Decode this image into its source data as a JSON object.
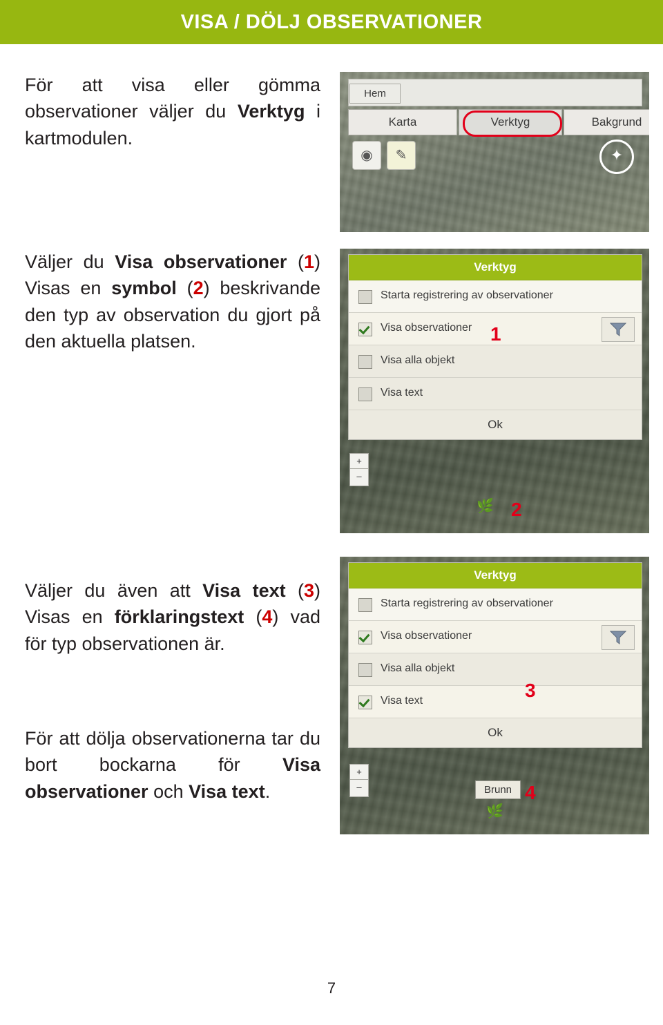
{
  "header": {
    "title": "VISA / DÖLJ OBSERVATIONER"
  },
  "page": {
    "number": "7"
  },
  "paragraphs": {
    "p1": {
      "seg1": "För att visa eller gömma observationer väljer du ",
      "bold1": "Verktyg",
      "seg2": " i kartmodulen."
    },
    "p2": {
      "seg1": "Väljer du ",
      "bold1": "Visa observationer",
      "seg2": " (",
      "num1": "1",
      "seg3": ") Visas en ",
      "bold2": "symbol",
      "seg4": " (",
      "num2": "2",
      "seg5": ") beskrivande den typ av observation du gjort på den aktuella platsen."
    },
    "p3": {
      "seg1": "Väljer du även att ",
      "bold1": "Visa text",
      "seg2": " (",
      "num1": "3",
      "seg3": ") Visas en ",
      "bold2": "förklaringstext",
      "seg4": " (",
      "num2": "4",
      "seg5": ") vad för typ observationen är."
    },
    "p4": {
      "seg1": "För att dölja observationerna tar du bort bockarna för ",
      "bold1": "Visa observationer",
      "seg2": " och ",
      "bold2": "Visa text",
      "seg3": "."
    }
  },
  "shot1": {
    "home_tab": "Hem",
    "tabs": [
      "Karta",
      "Verktyg",
      "Bakgrund"
    ],
    "camera_icon": "camera-icon",
    "edit_icon": "edit-icon",
    "compass_icon": "compass-icon"
  },
  "shot2": {
    "title": "Verktyg",
    "rows": [
      {
        "label": "Starta registrering av observationer",
        "checked": false
      },
      {
        "label": "Visa observationer",
        "checked": true
      },
      {
        "label": "Visa alla objekt",
        "checked": false
      },
      {
        "label": "Visa text",
        "checked": false
      }
    ],
    "ok_label": "Ok",
    "filter_icon": "funnel-icon",
    "zoom_in": "+",
    "zoom_out": "–",
    "callout_1": "1",
    "callout_2": "2",
    "poi_icon": "observation-marker-icon"
  },
  "shot3": {
    "title": "Verktyg",
    "rows": [
      {
        "label": "Starta registrering av observationer",
        "checked": false
      },
      {
        "label": "Visa observationer",
        "checked": true
      },
      {
        "label": "Visa alla objekt",
        "checked": false
      },
      {
        "label": "Visa text",
        "checked": true
      }
    ],
    "ok_label": "Ok",
    "filter_icon": "funnel-icon",
    "zoom_in": "+",
    "zoom_out": "–",
    "callout_3": "3",
    "callout_4": "4",
    "map_label": "Brunn",
    "poi_icon": "observation-marker-icon"
  },
  "colors": {
    "brand_green": "#97b711",
    "callout_red": "#e2001a",
    "text": "#231f20"
  }
}
